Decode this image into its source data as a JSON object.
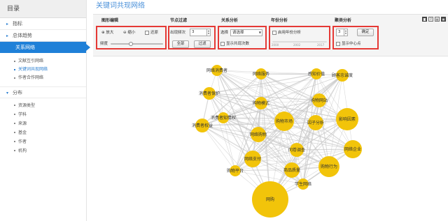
{
  "sidebar": {
    "title": "目录",
    "items": [
      {
        "caret": "▸",
        "label": "指标"
      },
      {
        "caret": "▸",
        "label": "总体趋势"
      }
    ],
    "active": "关系网络",
    "relation_subitems": [
      "文献互引网络",
      "关键词共现网络",
      "作者合作网络"
    ],
    "distribution": {
      "caret": "▾",
      "label": "分布"
    },
    "distribution_subitems": [
      "资源类型",
      "学科",
      "来源",
      "基金",
      "作者",
      "机构"
    ]
  },
  "page_title": "关键词共现网络",
  "toolbar": {
    "graph_edit": {
      "heading": "图形编辑",
      "zoom_in": "放大",
      "zoom_out": "缩小",
      "restore": "还原",
      "transparency_label": "频度",
      "slider_value": 0.38
    },
    "node_filter": {
      "heading": "节点过滤",
      "freq_label": "出现频次",
      "freq_value": "3",
      "all_button": "全部",
      "filter_button": "过滤"
    },
    "relation": {
      "heading": "关系分析",
      "select_prefix": "选择",
      "select_value": "请选择",
      "show_cooccur": "显示共现次数"
    },
    "year": {
      "heading": "年份分析",
      "enable_label": "启用年份分析",
      "ticks": [
        "2000",
        "2002",
        "2017"
      ]
    },
    "cluster": {
      "heading": "聚类分析",
      "value": "3",
      "confirm_button": "确定",
      "show_center": "显示中心点"
    },
    "icons": [
      "camera-icon",
      "help-icon",
      "export-icon",
      "settings-icon"
    ]
  },
  "graph": {
    "node_color": "#f2c40a",
    "edge_color": "#c8c8c8",
    "nodes": [
      {
        "label": "网络消费者",
        "size": 8
      },
      {
        "label": "网络服务",
        "size": 8
      },
      {
        "label": "感知价值",
        "size": 8
      },
      {
        "label": "顾客忠诚度",
        "size": 9
      },
      {
        "label": "消费者保护",
        "size": 9
      },
      {
        "label": "购物网站",
        "size": 10
      },
      {
        "label": "购物模式",
        "size": 9
      },
      {
        "label": "消费者知情权",
        "size": 8
      },
      {
        "label": "消费者权益",
        "size": 10
      },
      {
        "label": "购物市场",
        "size": 14
      },
      {
        "label": "因子分析",
        "size": 11
      },
      {
        "label": "影响因素",
        "size": 16
      },
      {
        "label": "网络购物",
        "size": 11
      },
      {
        "label": "问卷调查",
        "size": 10
      },
      {
        "label": "网络企业",
        "size": 13
      },
      {
        "label": "网络支付",
        "size": 12
      },
      {
        "label": "商品质量",
        "size": 11
      },
      {
        "label": "购物行为",
        "size": 15
      },
      {
        "label": "购物平台",
        "size": 8
      },
      {
        "label": "学生网络",
        "size": 8
      },
      {
        "label": "网购",
        "size": 26
      }
    ]
  }
}
